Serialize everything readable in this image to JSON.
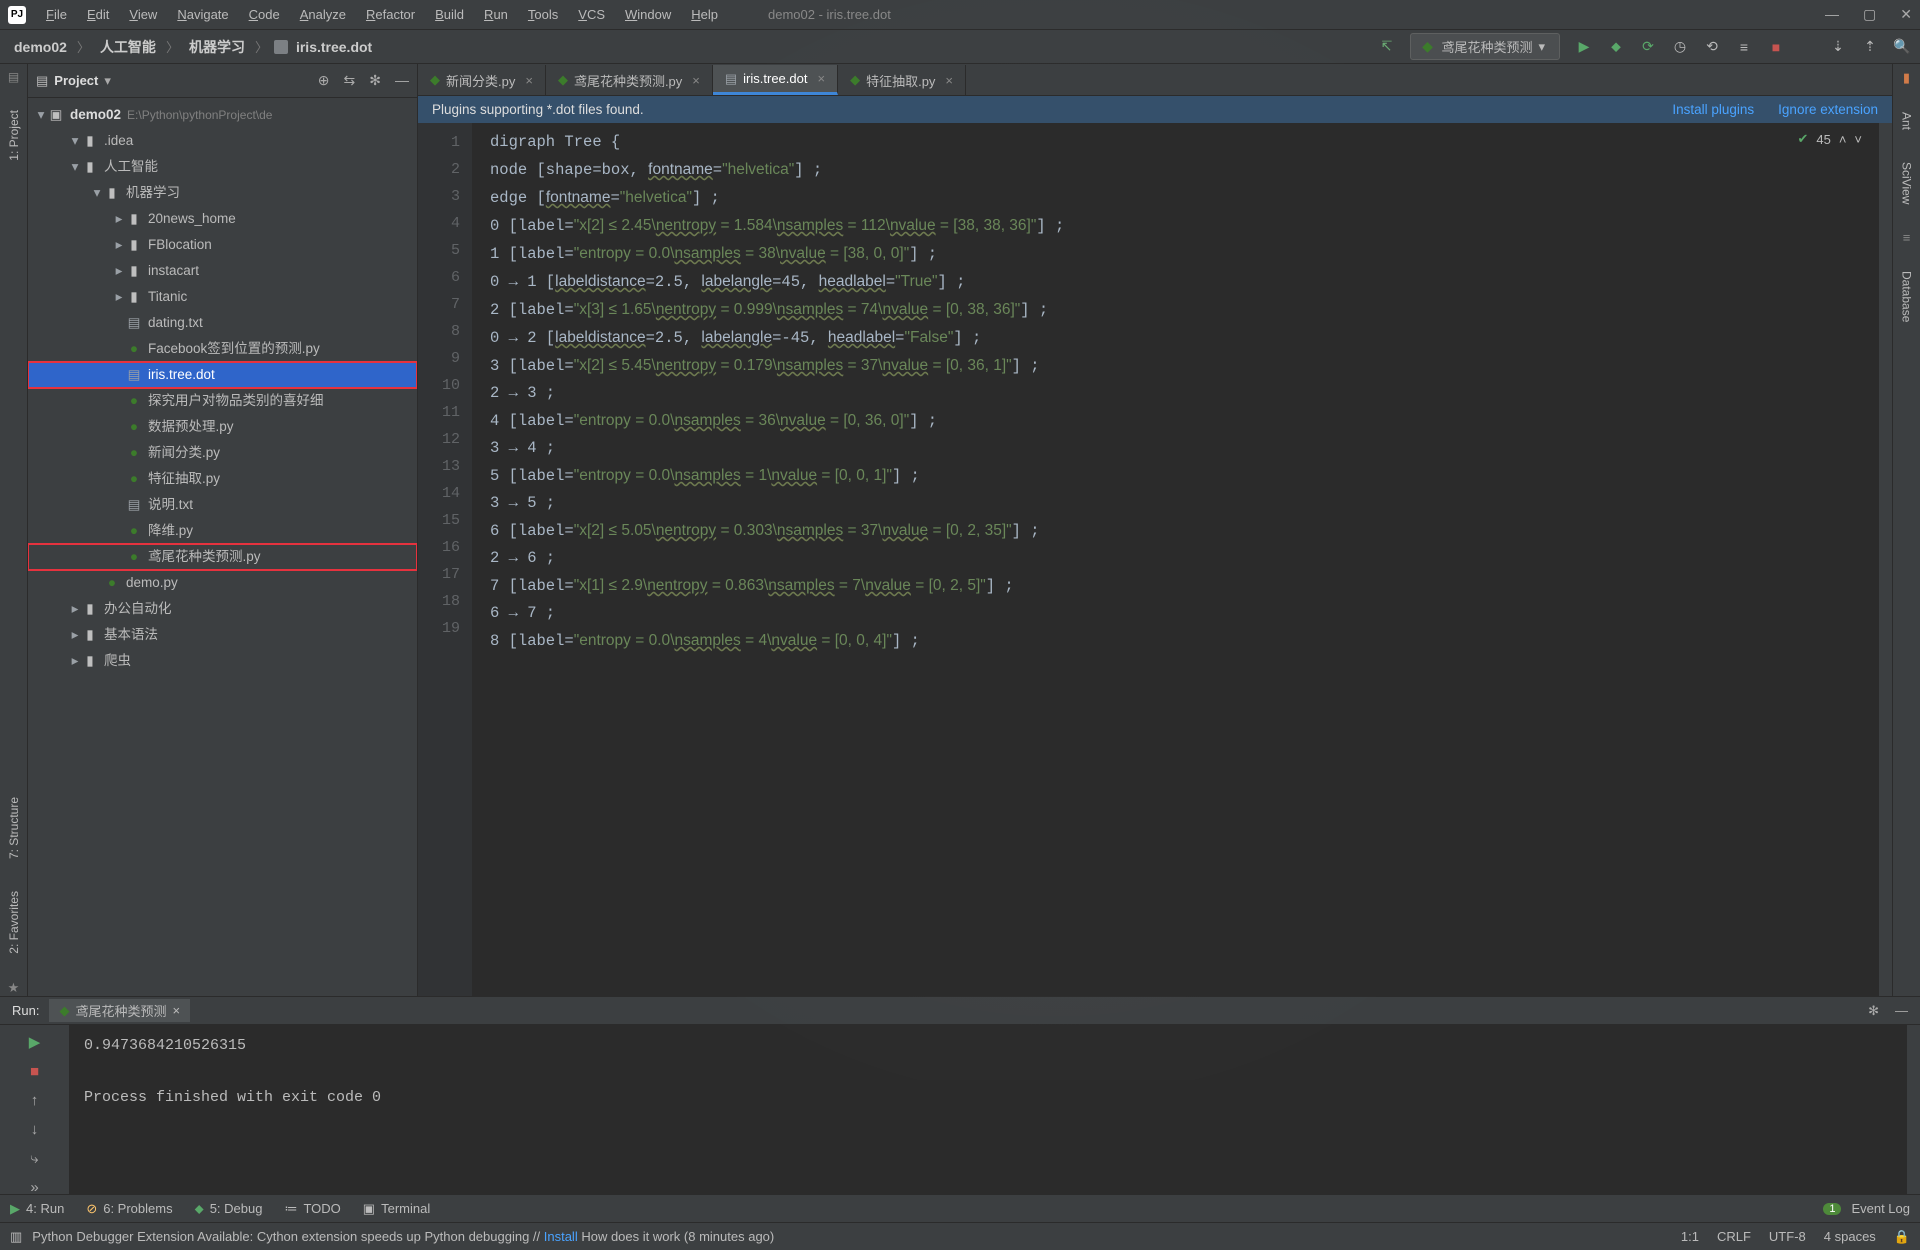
{
  "window": {
    "title": "demo02 - iris.tree.dot"
  },
  "menu": [
    "File",
    "Edit",
    "View",
    "Navigate",
    "Code",
    "Analyze",
    "Refactor",
    "Build",
    "Run",
    "Tools",
    "VCS",
    "Window",
    "Help"
  ],
  "breadcrumb": [
    "demo02",
    "人工智能",
    "机器学习",
    "iris.tree.dot"
  ],
  "run_config_label": "鸢尾花种类预测",
  "project_panel": {
    "title": "Project",
    "root": {
      "name": "demo02",
      "path": "E:\\Python\\pythonProject\\de"
    },
    "nodes": [
      {
        "depth": 1,
        "expand": "open",
        "icon": "folder",
        "label": ".idea"
      },
      {
        "depth": 1,
        "expand": "open",
        "icon": "folder",
        "label": "人工智能"
      },
      {
        "depth": 2,
        "expand": "open",
        "icon": "folder",
        "label": "机器学习"
      },
      {
        "depth": 3,
        "expand": "closed",
        "icon": "folder",
        "label": "20news_home"
      },
      {
        "depth": 3,
        "expand": "closed",
        "icon": "folder",
        "label": "FBlocation"
      },
      {
        "depth": 3,
        "expand": "closed",
        "icon": "folder",
        "label": "instacart"
      },
      {
        "depth": 3,
        "expand": "closed",
        "icon": "folder",
        "label": "Titanic"
      },
      {
        "depth": 3,
        "expand": "none",
        "icon": "txt",
        "label": "dating.txt"
      },
      {
        "depth": 3,
        "expand": "none",
        "icon": "py",
        "label": "Facebook签到位置的预测.py"
      },
      {
        "depth": 3,
        "expand": "none",
        "icon": "txt",
        "label": "iris.tree.dot",
        "selected": true,
        "hl": true
      },
      {
        "depth": 3,
        "expand": "none",
        "icon": "py",
        "label": "探究用户对物品类别的喜好细"
      },
      {
        "depth": 3,
        "expand": "none",
        "icon": "py",
        "label": "数据预处理.py"
      },
      {
        "depth": 3,
        "expand": "none",
        "icon": "py",
        "label": "新闻分类.py"
      },
      {
        "depth": 3,
        "expand": "none",
        "icon": "py",
        "label": "特征抽取.py"
      },
      {
        "depth": 3,
        "expand": "none",
        "icon": "txt",
        "label": "说明.txt"
      },
      {
        "depth": 3,
        "expand": "none",
        "icon": "py",
        "label": "降维.py"
      },
      {
        "depth": 3,
        "expand": "none",
        "icon": "py",
        "label": "鸢尾花种类预测.py",
        "hl": true
      },
      {
        "depth": 2,
        "expand": "none",
        "icon": "py",
        "label": "demo.py"
      },
      {
        "depth": 1,
        "expand": "closed",
        "icon": "folder",
        "label": "办公自动化"
      },
      {
        "depth": 1,
        "expand": "closed",
        "icon": "folder",
        "label": "基本语法"
      },
      {
        "depth": 1,
        "expand": "closed",
        "icon": "folder",
        "label": "爬虫"
      }
    ]
  },
  "left_tabs": [
    "1: Project"
  ],
  "left_tabs_bottom": [
    "2: Favorites",
    "7: Structure"
  ],
  "right_tabs": [
    "Ant",
    "SciView",
    "Database"
  ],
  "editor_tabs": [
    {
      "label": "新闻分类.py",
      "icon": "py"
    },
    {
      "label": "鸢尾花种类预测.py",
      "icon": "py"
    },
    {
      "label": "iris.tree.dot",
      "icon": "dot",
      "active": true
    },
    {
      "label": "特征抽取.py",
      "icon": "py"
    }
  ],
  "banner": {
    "msg": "Plugins supporting *.dot files found.",
    "link_install": "Install plugins",
    "link_ignore": "Ignore extension"
  },
  "inspection": {
    "count": "45"
  },
  "code_lines": [
    "digraph Tree {",
    "node [shape=box, fontname=\"helvetica\"] ;",
    "edge [fontname=\"helvetica\"] ;",
    "0 [label=\"x[2] ≤ 2.45\\nentropy = 1.584\\nsamples = 112\\nvalue = [38, 38, 36]\"] ;",
    "1 [label=\"entropy = 0.0\\nsamples = 38\\nvalue = [38, 0, 0]\"] ;",
    "0 → 1 [labeldistance=2.5, labelangle=45, headlabel=\"True\"] ;",
    "2 [label=\"x[3] ≤ 1.65\\nentropy = 0.999\\nsamples = 74\\nvalue = [0, 38, 36]\"] ;",
    "0 → 2 [labeldistance=2.5, labelangle=-45, headlabel=\"False\"] ;",
    "3 [label=\"x[2] ≤ 5.45\\nentropy = 0.179\\nsamples = 37\\nvalue = [0, 36, 1]\"] ;",
    "2 → 3 ;",
    "4 [label=\"entropy = 0.0\\nsamples = 36\\nvalue = [0, 36, 0]\"] ;",
    "3 → 4 ;",
    "5 [label=\"entropy = 0.0\\nsamples = 1\\nvalue = [0, 0, 1]\"] ;",
    "3 → 5 ;",
    "6 [label=\"x[2] ≤ 5.05\\nentropy = 0.303\\nsamples = 37\\nvalue = [0, 2, 35]\"] ;",
    "2 → 6 ;",
    "7 [label=\"x[1] ≤ 2.9\\nentropy = 0.863\\nsamples = 7\\nvalue = [0, 2, 5]\"] ;",
    "6 → 7 ;",
    "8 [label=\"entropy = 0.0\\nsamples = 4\\nvalue = [0, 0, 4]\"] ;"
  ],
  "run": {
    "header": "Run:",
    "tab": "鸢尾花种类预测",
    "output_lines": [
      "0.9473684210526315",
      "",
      "Process finished with exit code 0"
    ]
  },
  "tool_tabs": {
    "run": "4: Run",
    "problems": "6: Problems",
    "debug": "5: Debug",
    "todo": "TODO",
    "terminal": "Terminal",
    "event_log": "Event Log",
    "event_badge": "1"
  },
  "status": {
    "msg_prefix": "Python Debugger Extension Available: Cython extension speeds up Python debugging // ",
    "msg_link": "Install",
    "msg_suffix": "   How does it work (8 minutes ago)",
    "pos": "1:1",
    "eol": "CRLF",
    "enc": "UTF-8",
    "indent": "4 spaces"
  }
}
